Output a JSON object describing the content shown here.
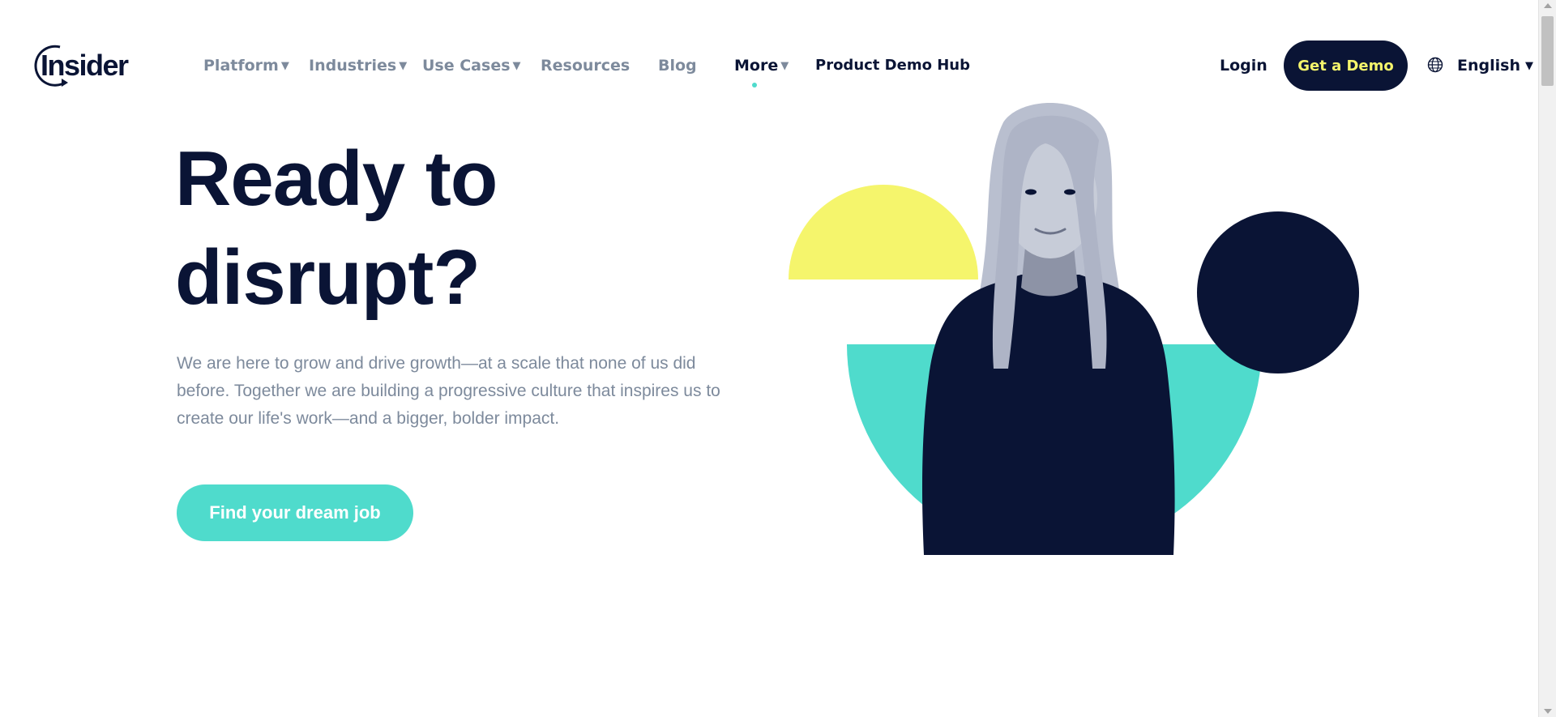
{
  "brand": {
    "name": "Insider"
  },
  "nav": {
    "items": [
      {
        "label": "Platform",
        "caret": "▼"
      },
      {
        "label": "Industries",
        "caret": "▼"
      },
      {
        "label": "Use Cases",
        "caret": "▼"
      },
      {
        "label": "Resources"
      },
      {
        "label": "Blog"
      },
      {
        "label": "More",
        "caret": "▼"
      },
      {
        "label": "Product Demo Hub"
      }
    ],
    "active": "More"
  },
  "header": {
    "login_label": "Login",
    "demo_label": "Get a Demo",
    "language_label": "English",
    "language_caret": "▼"
  },
  "hero": {
    "title_line1": "Ready to",
    "title_line2": "disrupt?",
    "description": "We are here to grow and drive growth—at a scale that none of us did before. Together we are building a progressive culture that inspires us to create our life's work—and a bigger, bolder impact.",
    "cta_label": "Find your dream job"
  },
  "colors": {
    "navy": "#0a1435",
    "teal": "#4fdbcc",
    "yellow": "#f5f56c",
    "muted_text": "#7d8a9c"
  },
  "icons": [
    "logo-ring-icon",
    "globe-icon",
    "caret-down-icon"
  ]
}
